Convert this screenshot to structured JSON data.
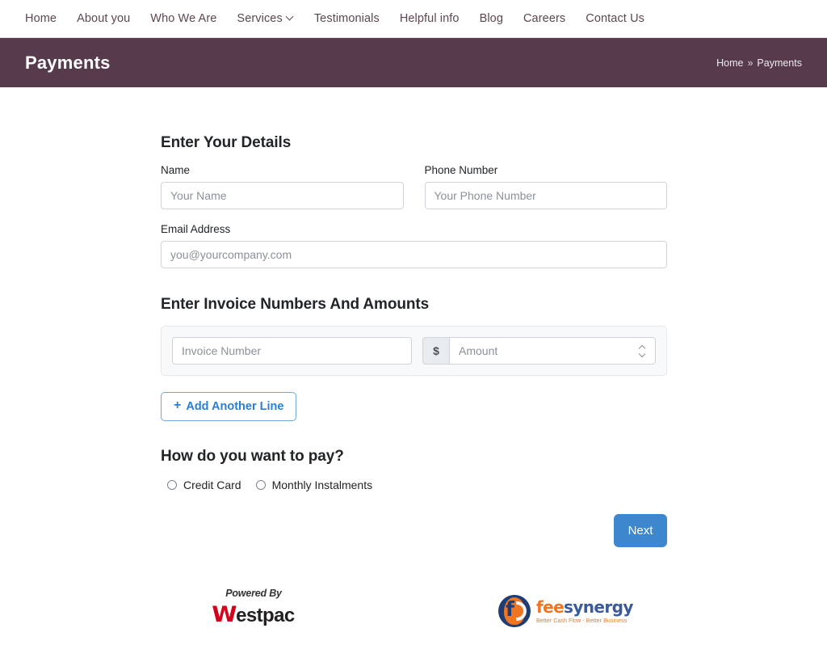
{
  "topnav": {
    "items": [
      {
        "label": "Home",
        "has_dropdown": false
      },
      {
        "label": "About you",
        "has_dropdown": false
      },
      {
        "label": "Who We Are",
        "has_dropdown": false
      },
      {
        "label": "Services",
        "has_dropdown": true
      },
      {
        "label": "Testimonials",
        "has_dropdown": false
      },
      {
        "label": "Helpful info",
        "has_dropdown": false
      },
      {
        "label": "Blog",
        "has_dropdown": false
      },
      {
        "label": "Careers",
        "has_dropdown": false
      },
      {
        "label": "Contact Us",
        "has_dropdown": false
      }
    ]
  },
  "banner": {
    "title": "Payments",
    "background_color": "#573b4c",
    "breadcrumb": {
      "home": "Home",
      "separator": "»",
      "current": "Payments"
    }
  },
  "details_section": {
    "title": "Enter Your Details",
    "name": {
      "label": "Name",
      "placeholder": "Your Name",
      "value": ""
    },
    "phone": {
      "label": "Phone Number",
      "placeholder": "Your Phone Number",
      "value": ""
    },
    "email": {
      "label": "Email Address",
      "placeholder": "you@yourcompany.com",
      "value": ""
    }
  },
  "invoice_section": {
    "title": "Enter Invoice Numbers And Amounts",
    "rows": [
      {
        "invoice_number": {
          "placeholder": "Invoice Number",
          "value": ""
        },
        "currency_symbol": "$",
        "amount": {
          "placeholder": "Amount",
          "value": ""
        }
      }
    ],
    "add_line_button": {
      "icon": "plus-icon",
      "label": "Add Another Line"
    }
  },
  "payment_section": {
    "title": "How do you want to pay?",
    "options": [
      {
        "label": "Credit Card",
        "selected": false
      },
      {
        "label": "Monthly Instalments",
        "selected": false
      }
    ]
  },
  "actions": {
    "next_label": "Next",
    "next_color": "#3c87ce"
  },
  "footer": {
    "westpac": {
      "powered_by": "Powered By",
      "logo_first_letter": "W",
      "logo_rest": "estpac",
      "mark_color": "#d4021d"
    },
    "feesynergy": {
      "word_first": "fee",
      "word_second": "synergy",
      "tagline": "Better Cash Flow - Better Business",
      "accent_color": "#ee7623",
      "secondary_color": "#3b5a9c"
    }
  }
}
